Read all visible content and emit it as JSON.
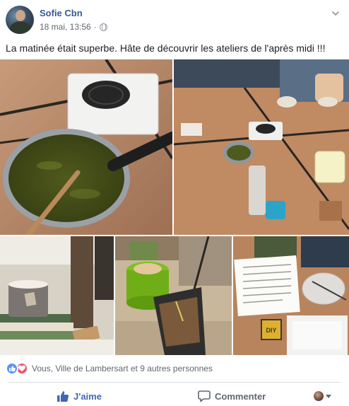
{
  "post": {
    "author": "Sofie Cbn",
    "date": "18 mai, 13:56",
    "text": "La matinée était superbe. Hâte de découvrir les ateliers de l'après midi !!!"
  },
  "photos": [
    {
      "subject": "saucepan-on-hotplate"
    },
    {
      "subject": "workshop-table"
    },
    {
      "subject": "candle-on-books"
    },
    {
      "subject": "compost-bin"
    },
    {
      "subject": "diy-label-document"
    }
  ],
  "photo_labels": {
    "diy_badge": "DIY"
  },
  "reactions": {
    "icons": [
      "like-icon",
      "love-icon"
    ],
    "summary": "Vous, Ville de Lambersart et 9 autres personnes",
    "colors": {
      "like": "#5890ff",
      "love": "#f25268"
    }
  },
  "actions": {
    "like_label": "J'aime",
    "comment_label": "Commenter",
    "colors": {
      "like": "#4267b2",
      "comment": "#606770"
    }
  }
}
